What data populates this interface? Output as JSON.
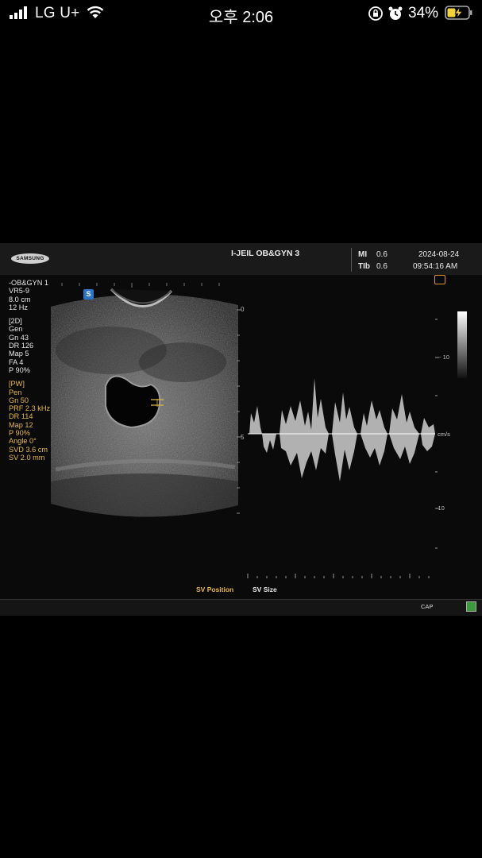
{
  "status_bar": {
    "carrier": "LG U+",
    "time": "오후 2:06",
    "battery_percent": "34%",
    "icons": [
      "signal-icon",
      "wifi-icon",
      "orientation-lock-icon",
      "alarm-icon",
      "battery-charging-icon"
    ]
  },
  "ultrasound": {
    "brand": "SAMSUNG",
    "hospital": "I-JEIL OB&GYN 3",
    "mi_label": "MI",
    "mi_value": "0.6",
    "tib_label": "TIb",
    "tib_value": "0.6",
    "date": "2024-08-24",
    "clock": "09:54:16 AM",
    "probe_badge": "S",
    "params_top": [
      "-OB&GYN 1",
      "VR5-9",
      "8.0 cm",
      "12 Hz"
    ],
    "params_2d": [
      "[2D]",
      "Gen",
      "Gn  43",
      "DR  126",
      "Map  5",
      "FA   4",
      "P    90%"
    ],
    "params_pw": [
      "[PW]",
      "Pen",
      "Gn  50",
      "PRF 2.3 kHz",
      "DR  114",
      "Map 12",
      "P    90%",
      "Angle 0°",
      "SVD 3.6 cm",
      "SV  2.0 mm"
    ],
    "depth_labels": [
      "0",
      "5"
    ],
    "velocity_labels": [
      "-10",
      "-10"
    ],
    "unit": "cm/s",
    "sv_position": "SV Position",
    "sv_size": "SV Size",
    "cap": "CAP",
    "colors": {
      "accent_yellow": "#e6b84a",
      "badge_blue": "#2a74c9",
      "orange": "#e0922c"
    }
  }
}
